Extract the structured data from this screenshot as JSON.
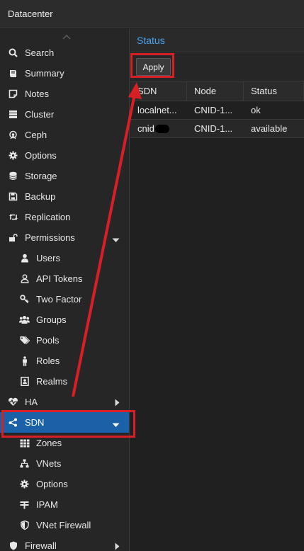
{
  "topbar": {
    "title": "Datacenter"
  },
  "sidebar": {
    "items": [
      {
        "label": "Search",
        "icon": "search-icon"
      },
      {
        "label": "Summary",
        "icon": "book-icon"
      },
      {
        "label": "Notes",
        "icon": "note-icon"
      },
      {
        "label": "Cluster",
        "icon": "server-icon"
      },
      {
        "label": "Ceph",
        "icon": "ceph-icon"
      },
      {
        "label": "Options",
        "icon": "gear-icon"
      },
      {
        "label": "Storage",
        "icon": "database-icon"
      },
      {
        "label": "Backup",
        "icon": "floppy-icon"
      },
      {
        "label": "Replication",
        "icon": "retweet-icon"
      },
      {
        "label": "Permissions",
        "icon": "unlock-icon"
      },
      {
        "label": "Users",
        "icon": "user-icon"
      },
      {
        "label": "API Tokens",
        "icon": "user-outline-icon"
      },
      {
        "label": "Two Factor",
        "icon": "key-icon"
      },
      {
        "label": "Groups",
        "icon": "users-icon"
      },
      {
        "label": "Pools",
        "icon": "tags-icon"
      },
      {
        "label": "Roles",
        "icon": "male-icon"
      },
      {
        "label": "Realms",
        "icon": "address-book-icon"
      },
      {
        "label": "HA",
        "icon": "heartbeat-icon"
      },
      {
        "label": "SDN",
        "icon": "sdn-icon"
      },
      {
        "label": "Zones",
        "icon": "grid-icon"
      },
      {
        "label": "VNets",
        "icon": "network-icon"
      },
      {
        "label": "Options",
        "icon": "gear-icon"
      },
      {
        "label": "IPAM",
        "icon": "ipam-icon"
      },
      {
        "label": "VNet Firewall",
        "icon": "shield-icon"
      },
      {
        "label": "Firewall",
        "icon": "shield-icon"
      }
    ]
  },
  "panel": {
    "title": "Status",
    "apply_label": "Apply",
    "columns": [
      "SDN",
      "Node",
      "Status"
    ],
    "rows": [
      {
        "sdn": "localnet...",
        "node": "CNID-1...",
        "status": "ok"
      },
      {
        "sdn": "cnid",
        "node": "CNID-1...",
        "status": "available"
      }
    ]
  },
  "colors": {
    "accent": "#4aa3ea",
    "selected": "#1b61a8",
    "highlight": "#d81f26"
  }
}
